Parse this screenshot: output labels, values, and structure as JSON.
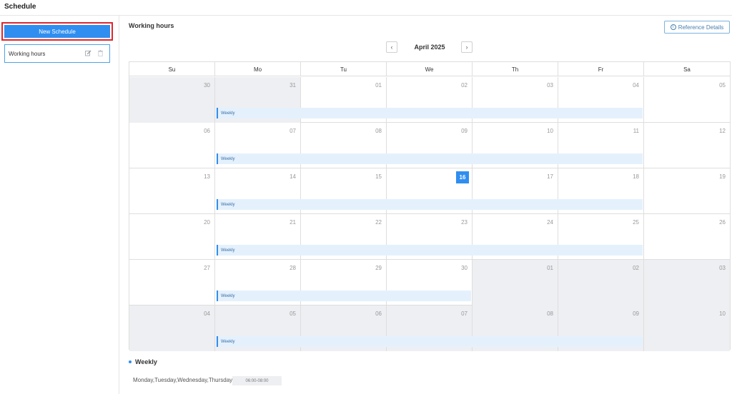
{
  "header": {
    "title": "Schedule"
  },
  "sidebar": {
    "new_schedule_label": "New Schedule",
    "items": [
      {
        "label": "Working hours"
      }
    ]
  },
  "main": {
    "title": "Working hours",
    "reference_details_label": "Reference Details",
    "month_label": "April 2025",
    "weekdays": [
      "Su",
      "Mo",
      "Tu",
      "We",
      "Th",
      "Fr",
      "Sa"
    ],
    "weeks": [
      {
        "days": [
          "30",
          "31",
          "01",
          "02",
          "03",
          "04",
          "05"
        ],
        "event": "Weekly"
      },
      {
        "days": [
          "06",
          "07",
          "08",
          "09",
          "10",
          "11",
          "12"
        ],
        "event": "Weekly"
      },
      {
        "days": [
          "13",
          "14",
          "15",
          "16",
          "17",
          "18",
          "19"
        ],
        "event": "Weekly"
      },
      {
        "days": [
          "20",
          "21",
          "22",
          "23",
          "24",
          "25",
          "26"
        ],
        "event": "Weekly"
      },
      {
        "days": [
          "27",
          "28",
          "29",
          "30",
          "01",
          "02",
          "03"
        ],
        "event": "Weekly"
      },
      {
        "days": [
          "04",
          "05",
          "06",
          "07",
          "08",
          "09",
          "10"
        ],
        "event": "Weekly"
      }
    ],
    "today": "16"
  },
  "legend": {
    "title": "Weekly",
    "days_text": "Monday,Tuesday,Wednesday,Thursday,Friday",
    "time_range": "06:00-08:00"
  },
  "colors": {
    "accent": "#2f8ef0",
    "highlight_border": "#e0262b",
    "event_bg": "#e4f1fd",
    "other_month_bg": "#eeeff2"
  }
}
